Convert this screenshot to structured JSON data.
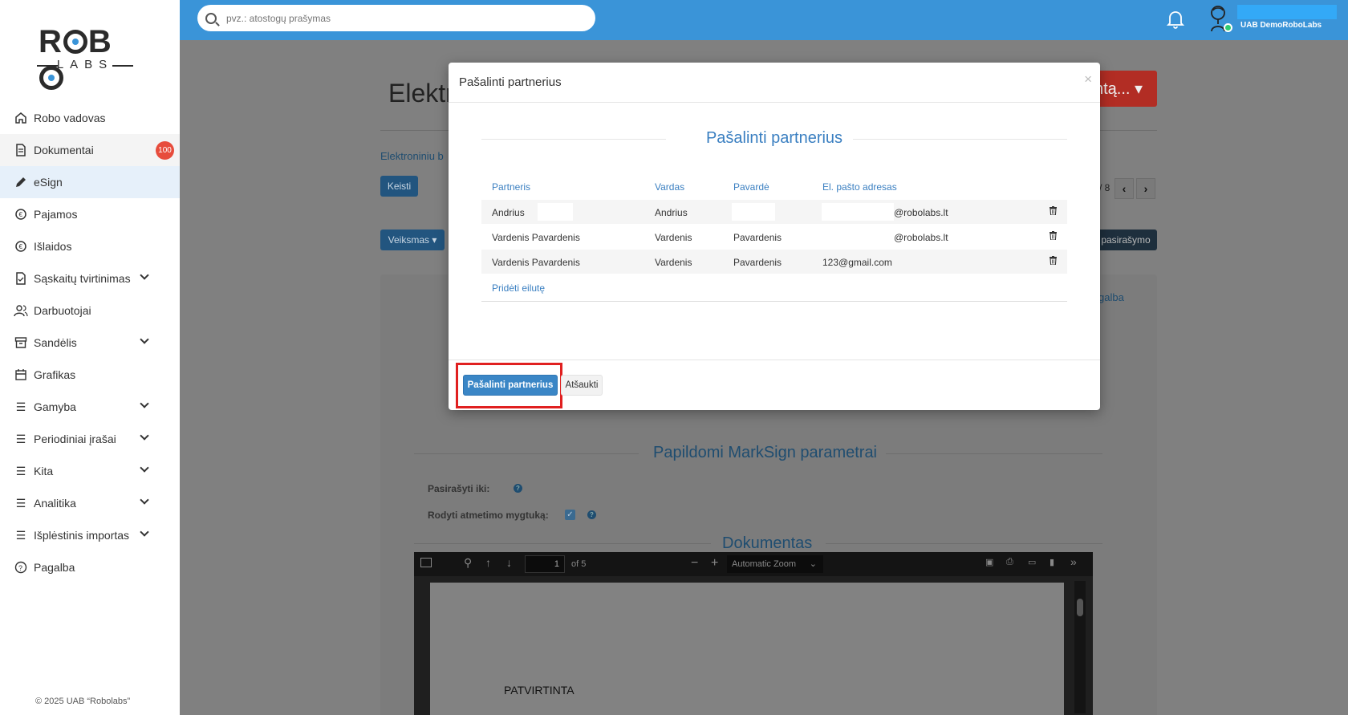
{
  "app": {
    "logo_text": "ROBO LABS",
    "copyright": "© 2025 UAB “Robolabs”"
  },
  "search": {
    "placeholder": "pvz.: atostogų prašymas"
  },
  "header": {
    "company": "UAB DemoRoboLabs",
    "status": "online"
  },
  "sidebar": {
    "items": [
      {
        "label": "Robo vadovas",
        "icon": "home-icon"
      },
      {
        "label": "Dokumentai",
        "icon": "document-icon",
        "badge": "100"
      },
      {
        "label": "eSign",
        "icon": "pen-icon",
        "active": true
      },
      {
        "label": "Pajamos",
        "icon": "income-icon"
      },
      {
        "label": "Išlaidos",
        "icon": "expense-icon"
      },
      {
        "label": "Sąskaitų tvirtinimas",
        "icon": "invoice-check-icon",
        "expandable": true
      },
      {
        "label": "Darbuotojai",
        "icon": "users-icon"
      },
      {
        "label": "Sandėlis",
        "icon": "warehouse-icon",
        "expandable": true
      },
      {
        "label": "Grafikas",
        "icon": "calendar-icon"
      },
      {
        "label": "Gamyba",
        "icon": "list-icon",
        "expandable": true
      },
      {
        "label": "Periodiniai įrašai",
        "icon": "list-icon",
        "expandable": true
      },
      {
        "label": "Kita",
        "icon": "list-icon",
        "expandable": true
      },
      {
        "label": "Analitika",
        "icon": "list-icon",
        "expandable": true
      },
      {
        "label": "Išplėstinis importas",
        "icon": "list-icon",
        "expandable": true
      },
      {
        "label": "Pagalba",
        "icon": "help-icon"
      }
    ]
  },
  "background": {
    "title": "Elektr",
    "red_button": "ntą...",
    "link_text": "Elektroniniu b",
    "change_button": "Keisti",
    "action_button": "Veiksmas",
    "page_indicator": "/ 8",
    "sign_button": "pasirašymo",
    "help_link": "galba",
    "section_markSign": "Papildomi MarkSign parametrai",
    "sign_until_label": "Pasirašyti iki:",
    "show_reject_label": "Rodyti atmetimo mygtuką:",
    "section_document": "Dokumentas",
    "pdf": {
      "page": "1",
      "of": "of 5",
      "zoom": "Automatic Zoom",
      "page_text": "PATVIRTINTA"
    }
  },
  "modal": {
    "title": "Pašalinti partnerius",
    "section_title": "Pašalinti partnerius",
    "columns": [
      "Partneris",
      "Vardas",
      "Pavardė",
      "El. pašto adresas"
    ],
    "rows": [
      {
        "partner": "Andrius",
        "name": "Andrius",
        "surname": "",
        "email": "@robolabs.lt"
      },
      {
        "partner": "Vardenis Pavardenis",
        "name": "Vardenis",
        "surname": "Pavardenis",
        "email": "@robolabs.lt"
      },
      {
        "partner": "Vardenis Pavardenis",
        "name": "Vardenis",
        "surname": "Pavardenis",
        "email": "123@gmail.com"
      }
    ],
    "add_row": "Pridėti eilutę",
    "confirm_button": "Pašalinti partnerius",
    "cancel_button": "Atšaukti"
  }
}
